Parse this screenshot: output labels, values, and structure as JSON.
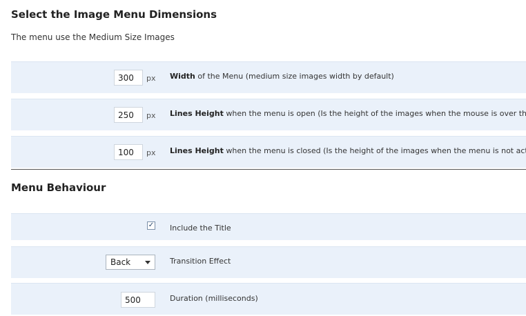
{
  "section1": {
    "title": "Select the Image Menu Dimensions",
    "subtitle": "The menu use the Medium Size Images"
  },
  "dimensions": [
    {
      "value": "300",
      "unit": "px",
      "bold": "Width",
      "text": " of the Menu (medium size images width by default)"
    },
    {
      "value": "250",
      "unit": "px",
      "bold": "Lines Height",
      "text": " when the menu is open (Is the height of the images when the mouse is over them)"
    },
    {
      "value": "100",
      "unit": "px",
      "bold": "Lines Height",
      "text": " when the menu is closed (Is the height of the images when the menu is not activated)"
    }
  ],
  "section2": {
    "title": "Menu Behaviour"
  },
  "behaviour": {
    "include_title": {
      "checked": true,
      "label": "Include the Title"
    },
    "transition": {
      "selected": "Back",
      "label": "Transition Effect"
    },
    "duration": {
      "value": "500",
      "label": "Duration (milliseconds)"
    }
  }
}
